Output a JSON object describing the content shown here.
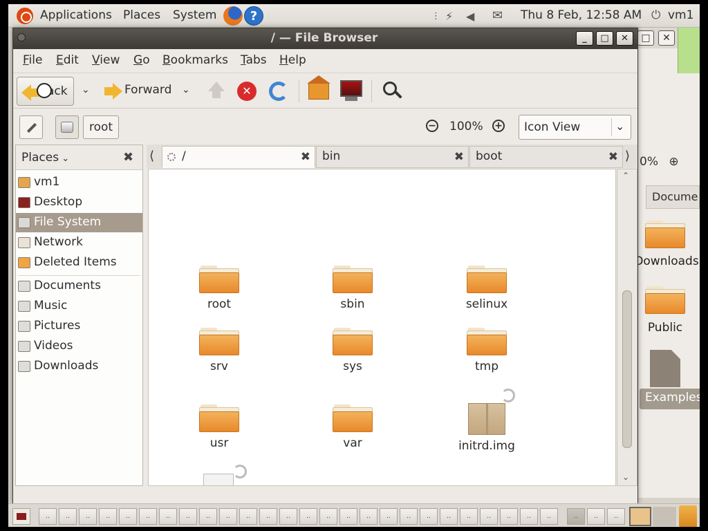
{
  "top_panel": {
    "menus": [
      "Applications",
      "Places",
      "System"
    ],
    "clock": "Thu  8 Feb, 12:58 AM",
    "user": "vm1"
  },
  "window": {
    "title": "/ — File Browser",
    "buttons": {
      "minimize": "_",
      "maximize": "□",
      "close": "✕"
    }
  },
  "menubar": {
    "items": [
      {
        "key": "F",
        "rest": "ile"
      },
      {
        "key": "E",
        "rest": "dit"
      },
      {
        "key": "V",
        "rest": "iew"
      },
      {
        "key": "G",
        "rest": "o"
      },
      {
        "key": "B",
        "rest": "ookmarks"
      },
      {
        "key": "T",
        "rest": "abs"
      },
      {
        "key": "H",
        "rest": "elp"
      }
    ]
  },
  "toolbar": {
    "back_label": "ack",
    "forward_label": "Forward"
  },
  "location": {
    "root_label": "root",
    "zoom": "100%",
    "view_mode": "Icon View"
  },
  "sidebar": {
    "header": "Places",
    "places": [
      {
        "label": "vm1",
        "icon": "home-folder-icon"
      },
      {
        "label": "Desktop",
        "icon": "desktop-icon"
      },
      {
        "label": "File System",
        "icon": "drive-icon",
        "selected": true
      },
      {
        "label": "Network",
        "icon": "network-icon"
      },
      {
        "label": "Deleted Items",
        "icon": "trash-icon"
      }
    ],
    "bookmarks": [
      {
        "label": "Documents",
        "icon": "documents-folder-icon"
      },
      {
        "label": "Music",
        "icon": "music-folder-icon"
      },
      {
        "label": "Pictures",
        "icon": "pictures-folder-icon"
      },
      {
        "label": "Videos",
        "icon": "videos-folder-icon"
      },
      {
        "label": "Downloads",
        "icon": "downloads-folder-icon"
      }
    ]
  },
  "tabs": [
    {
      "label": "/",
      "active": true
    },
    {
      "label": "bin",
      "active": false
    },
    {
      "label": "boot",
      "active": false
    }
  ],
  "files": [
    {
      "name": "root",
      "type": "folder"
    },
    {
      "name": "sbin",
      "type": "folder"
    },
    {
      "name": "selinux",
      "type": "folder"
    },
    {
      "name": "srv",
      "type": "folder"
    },
    {
      "name": "sys",
      "type": "folder"
    },
    {
      "name": "tmp",
      "type": "folder"
    },
    {
      "name": "usr",
      "type": "folder"
    },
    {
      "name": "var",
      "type": "folder"
    },
    {
      "name": "initrd.img",
      "type": "archive-link"
    }
  ],
  "background_window": {
    "zoom_partial": "0%",
    "tab_partial": "Docume",
    "items": [
      "Downloads",
      "Public",
      "Examples"
    ]
  }
}
